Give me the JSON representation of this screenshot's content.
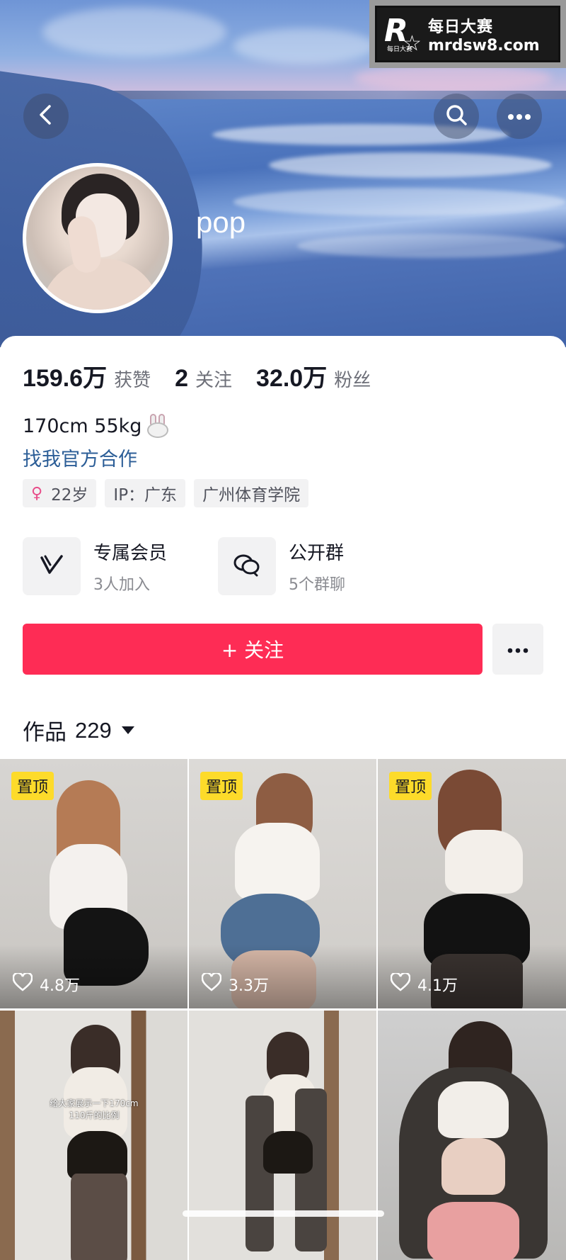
{
  "watermark": {
    "logo_letter": "R",
    "logo_mini": "每日大赛",
    "title": "每日大赛",
    "site": "mrdsw8.com"
  },
  "profile": {
    "username": "pop"
  },
  "stats": [
    {
      "value": "159.6万",
      "label": "获赞"
    },
    {
      "value": "2",
      "label": "关注"
    },
    {
      "value": "32.0万",
      "label": "粉丝"
    }
  ],
  "bio": {
    "text": "170cm 55kg",
    "emoji": "rabbit-face",
    "link": "找我官方合作"
  },
  "tags": {
    "age_symbol": "♀",
    "age": "22岁",
    "ip": "IP：广东",
    "school": "广州体育学院"
  },
  "features": [
    {
      "title": "专属会员",
      "subtitle": "3人加入",
      "icon": "vip-v-icon"
    },
    {
      "title": "公开群",
      "subtitle": "5个群聊",
      "icon": "group-chat-icon"
    }
  ],
  "actions": {
    "follow_label": "+ 关注"
  },
  "works": {
    "label": "作品",
    "count": "229"
  },
  "grid": [
    {
      "badge": "置顶",
      "likes": "4.8万"
    },
    {
      "badge": "置顶",
      "likes": "3.3万"
    },
    {
      "badge": "置顶",
      "likes": "4.1万"
    },
    {
      "badge": "",
      "likes": "",
      "caption_line1": "给大家展示一下170cm",
      "caption_line2": "110斤的比例"
    },
    {
      "badge": "",
      "likes": ""
    },
    {
      "badge": "",
      "likes": ""
    }
  ],
  "colors": {
    "accent": "#fe2c55",
    "link": "#2c5e97",
    "pin_badge": "#fddb2a"
  }
}
